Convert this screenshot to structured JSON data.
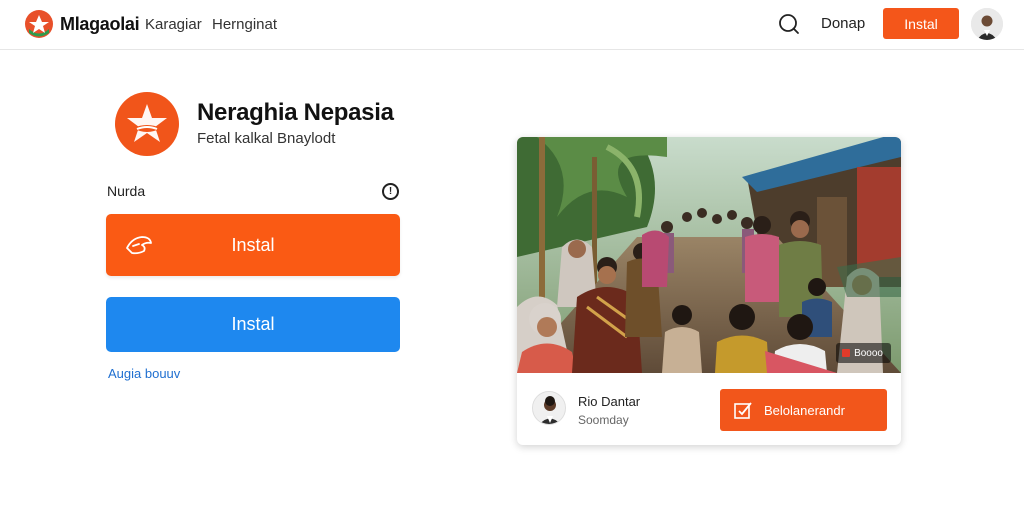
{
  "header": {
    "brand": "Mlagaolai",
    "nav": [
      "Karagiar",
      "Hernginat"
    ],
    "login_label": "Donap",
    "install_label": "Instal",
    "icons": {
      "logo": "brand-logo",
      "search": "chat-search-icon",
      "avatar": "user-avatar"
    }
  },
  "app": {
    "title": "Neraghia Nepasia",
    "subtitle": "Fetal kalkal Bnaylodt",
    "section_label": "Nurda",
    "info_icon": "info-icon",
    "primary_button": "Instal",
    "secondary_button": "Instal",
    "link": "Augia bouuv"
  },
  "card": {
    "badge": "Boooo",
    "author_name": "Rio Dantar",
    "author_sub": "Soomday",
    "action_button": "Belolanerandr",
    "icons": {
      "action": "edit-icon"
    }
  },
  "colors": {
    "accent_orange": "#f4561a",
    "primary_blue": "#1e88ef",
    "link_blue": "#1f6fd0"
  }
}
